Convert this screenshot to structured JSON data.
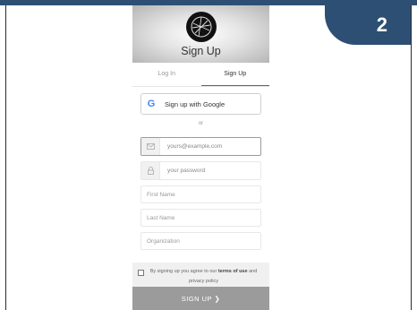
{
  "step_badge": "2",
  "header": {
    "title": "Sign Up"
  },
  "tabs": [
    {
      "label": "Log In",
      "active": false
    },
    {
      "label": "Sign Up",
      "active": true
    }
  ],
  "google_button": {
    "label": "Sign up with Google",
    "icon": "G"
  },
  "divider_text": "or",
  "fields": {
    "email": {
      "value": "yours@example.com",
      "icon": "envelope-icon"
    },
    "password": {
      "value": "your password",
      "icon": "lock-icon"
    },
    "first_name": {
      "value": "First Name"
    },
    "last_name": {
      "value": "Last Name"
    },
    "organization": {
      "value": "Organization"
    }
  },
  "terms": {
    "prefix": "By signing up you agree to our",
    "terms_link": "terms of use",
    "and": "and",
    "privacy_link": "privacy policy"
  },
  "submit": {
    "label": "SIGN UP ❯"
  },
  "colors": {
    "accent": "#2d4f73",
    "submit_bg": "#9b9b9b",
    "google_blue": "#4285F4"
  }
}
